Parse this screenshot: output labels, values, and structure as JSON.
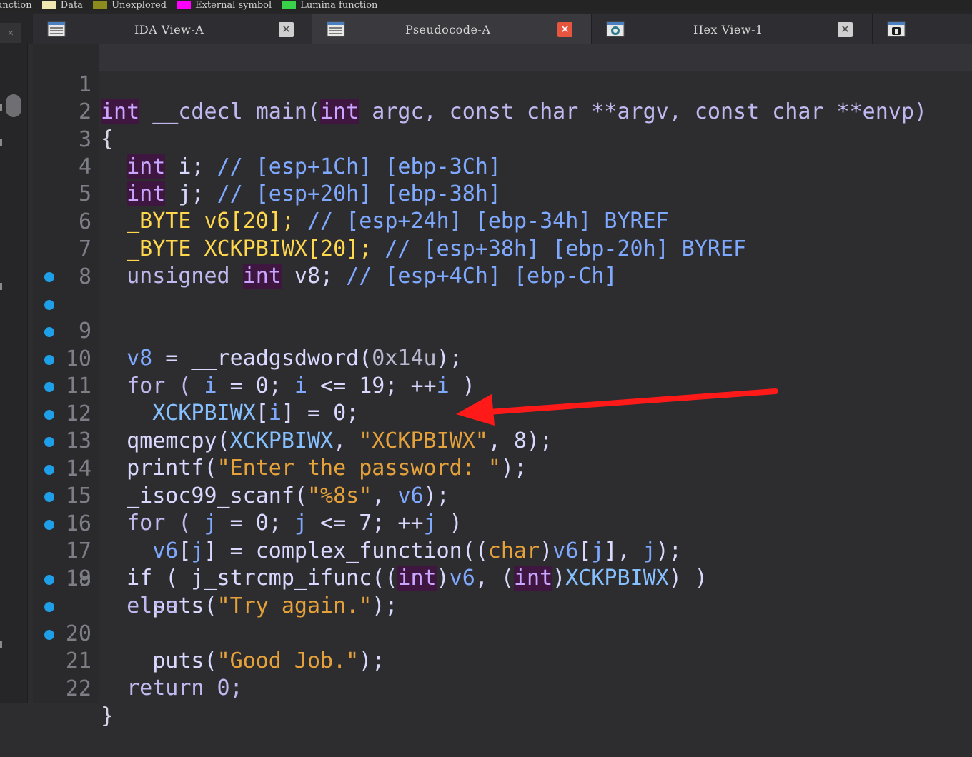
{
  "legend": [
    {
      "label": "Function",
      "color": "#3a3a3a"
    },
    {
      "label": "Data",
      "color": "#f0e6b0"
    },
    {
      "label": "Unexplored",
      "color": "#8b8b1e"
    },
    {
      "label": "External symbol",
      "color": "#ff00ff"
    },
    {
      "label": "Lumina function",
      "color": "#39d14a"
    }
  ],
  "tabs": [
    {
      "label": "IDA View-A",
      "active": false,
      "icon": "listing-icon"
    },
    {
      "label": "Pseudocode-A",
      "active": true,
      "icon": "listing-icon"
    },
    {
      "label": "Hex View-1",
      "active": false,
      "icon": "hex-view-icon"
    },
    {
      "label": "",
      "active": false,
      "icon": "structures-icon"
    }
  ],
  "colors": {
    "keyword_bg": "#3e1640",
    "breakpoint_dot": "#1f9fe8",
    "arrow": "#ff1a1a",
    "string": "#e6a23a"
  },
  "code": {
    "line_numbers": [
      "1",
      "2",
      "3",
      "4",
      "5",
      "6",
      "7",
      "8",
      "9",
      "10",
      "11",
      "12",
      "13",
      "14",
      "15",
      "16",
      "17",
      "18",
      "19",
      "20",
      "21",
      "22"
    ],
    "has_dot": [
      false,
      false,
      false,
      false,
      false,
      false,
      false,
      false,
      true,
      true,
      true,
      true,
      true,
      true,
      true,
      true,
      true,
      true,
      false,
      true,
      true,
      true
    ],
    "line1": {
      "int": "int",
      "rest1": " __cdecl main(",
      "int2": "int",
      "rest2": " argc, const char **argv, const char **envp)"
    },
    "line2": "{",
    "line3": {
      "t": "int",
      "v": " i; ",
      "c": "// [esp+1Ch] [ebp-3Ch]"
    },
    "line4": {
      "t": "int",
      "v": " j; ",
      "c": "// [esp+20h] [ebp-38h]"
    },
    "line5": {
      "t": "_BYTE",
      "v": " v6[20]; ",
      "c": "// [esp+24h] [ebp-34h] BYREF"
    },
    "line6": {
      "t": "_BYTE",
      "g": " XCKPBIWX",
      "v": "[20]; ",
      "c": "// [esp+38h] [ebp-20h] BYREF"
    },
    "line7": {
      "t1": "unsigned ",
      "t2": "int",
      "v": " v8; ",
      "c": "// [esp+4Ch] [ebp-Ch]"
    },
    "line9": {
      "a": "v8",
      "b": " = __readgsdword(",
      "n": "0x14u",
      "e": ");"
    },
    "line10": {
      "a": "for ( ",
      "i1": "i",
      "b": " = 0; ",
      "i2": "i",
      "c": " <= 19; ++",
      "i3": "i",
      "e": " )"
    },
    "line11": {
      "g": "XCKPBIWX",
      "a": "[",
      "i": "i",
      "b": "] = 0;"
    },
    "line12": {
      "a": "qmemcpy(",
      "g": "XCKPBIWX",
      "b": ", ",
      "s": "\"XCKPBIWX\"",
      "e": ", 8);"
    },
    "line13": {
      "a": "printf(",
      "s": "\"Enter the password: \"",
      "e": ");"
    },
    "line14": {
      "a": "_isoc99_scanf(",
      "s": "\"%8s\"",
      "b": ", ",
      "v": "v6",
      "e": ");"
    },
    "line15": {
      "a": "for ( ",
      "j1": "j",
      "b": " = 0; ",
      "j2": "j",
      "c": " <= 7; ++",
      "j3": "j",
      "e": " )"
    },
    "line16": {
      "v": "v6",
      "a": "[",
      "j1": "j",
      "b": "] = complex_function((",
      "k": "char",
      "c": ")",
      "v2": "v6",
      "d": "[",
      "j2": "j",
      "e": "], ",
      "j3": "j",
      "f": ");"
    },
    "line17": {
      "a": "if ( j_strcmp_ifunc((",
      "k1": "int",
      "b": ")",
      "v": "v6",
      "c": ", (",
      "k2": "int",
      "d": ")",
      "g": "XCKPBIWX",
      "e": ") )"
    },
    "line18": {
      "a": "puts(",
      "s": "\"Try again.\"",
      "e": ");"
    },
    "line19": "else",
    "line20": {
      "a": "puts(",
      "s": "\"Good Job.\"",
      "e": ");"
    },
    "line21": "return 0;",
    "line22": "}"
  }
}
